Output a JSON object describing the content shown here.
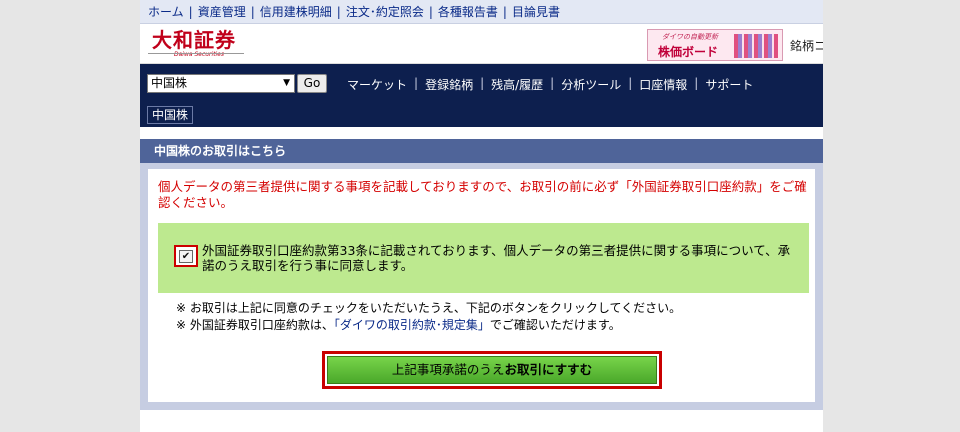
{
  "top_links": [
    {
      "label": "ホーム"
    },
    {
      "label": "資産管理"
    },
    {
      "label": "信用建株明細"
    },
    {
      "label": "注文･約定照会"
    },
    {
      "label": "各種報告書"
    },
    {
      "label": "目論見書"
    }
  ],
  "brand": {
    "logo_text": "大和証券",
    "logo_sub": "Daiwa Securities",
    "banner_small": "ダイワの自動更新",
    "banner_title": "株価ボード",
    "meigara_text": "銘柄コ"
  },
  "nav": {
    "product_select_value": "中国株",
    "go_label": "Go",
    "menu": [
      "マーケット",
      "登録銘柄",
      "残高/履歴",
      "分析ツール",
      "口座情報",
      "サポート"
    ],
    "active_tab": "中国株"
  },
  "panel": {
    "title": "中国株のお取引はこちら",
    "red_note": "個人データの第三者提供に関する事項を記載しておりますので、お取引の前に必ず「外国証券取引口座約款」をご確認ください。",
    "agree_text": "外国証券取引口座約款第33条に記載されております、個人データの第三者提供に関する事項について、承諾のうえ取引を行う事に同意します。",
    "checkbox_checked_glyph": "✔",
    "note1": "※ お取引は上記に同意のチェックをいただいたうえ、下記のボタンをクリックしてください。",
    "note2_prefix": "※ 外国証券取引口座約款は、",
    "note2_link": "「ダイワの取引約款･規定集」",
    "note2_suffix": "でご確認いただけます。",
    "submit_prefix": "上記事項承諾のうえ",
    "submit_bold": "お取引にすすむ"
  }
}
